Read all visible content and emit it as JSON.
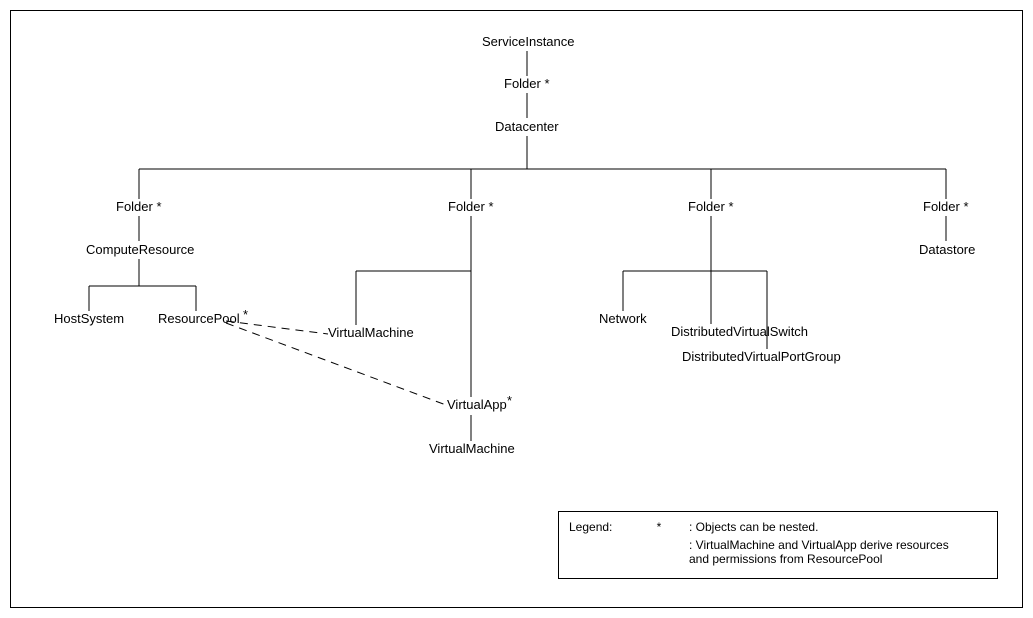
{
  "nodes": {
    "service_instance": "ServiceInstance",
    "folder_1": "Folder *",
    "datacenter": "Datacenter",
    "folder_a": "Folder *",
    "folder_b": "Folder *",
    "folder_c": "Folder *",
    "folder_d": "Folder *",
    "compute_resource": "ComputeResource",
    "host_system": "HostSystem",
    "resource_pool": "ResourcePool",
    "resource_pool_star": "*",
    "virtual_machine_1": "VirtualMachine",
    "virtual_app": "VirtualApp",
    "virtual_app_star": "*",
    "virtual_machine_2": "VirtualMachine",
    "network": "Network",
    "dvs": "DistributedVirtualSwitch",
    "dvpg": "DistributedVirtualPortGroup",
    "datastore": "Datastore"
  },
  "legend": {
    "title": "Legend:",
    "row1_symbol": "*",
    "row1_text": ": Objects can be nested.",
    "row2_text1": ": VirtualMachine and VirtualApp derive resources",
    "row2_text2": "  and permissions from ResourcePool"
  }
}
